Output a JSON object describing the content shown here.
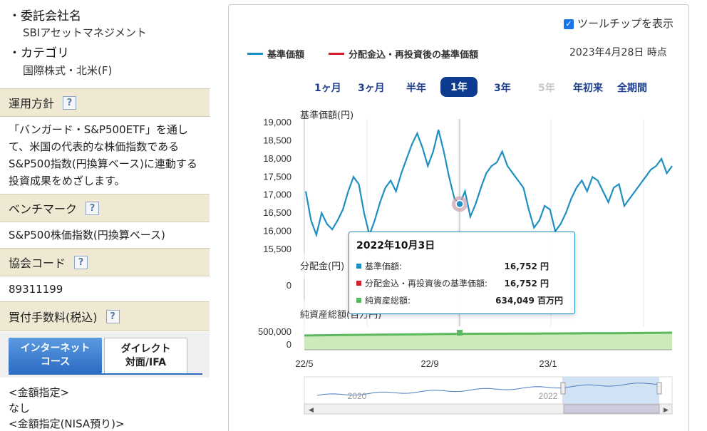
{
  "fund": {
    "trustee_label": "・委託会社名",
    "trustee_value": "SBIアセットマネジメント",
    "category_label": "・カテゴリ",
    "category_value": "国際株式・北米(F)"
  },
  "sections": {
    "policy_title": "運用方針",
    "policy_text": "「バンガード・S&P500ETF」を通して、米国の代表的な株価指数であるS&P500指数(円換算ベース)に連動する投資成果をめざします。",
    "benchmark_title": "ベンチマーク",
    "benchmark_text": "S&P500株価指数(円換算ベース)",
    "code_title": "協会コード",
    "code_text": "89311199",
    "fee_title": "買付手数料(税込)",
    "help_icon": "?"
  },
  "tabs": {
    "internet_line1": "インターネット",
    "internet_line2": "コース",
    "direct_line1": "ダイレクト",
    "direct_line2": "対面/IFA"
  },
  "fee_notes": {
    "amount": "<金額指定>",
    "amount_value": "なし",
    "nisa": "<金額指定(NISA預り)>"
  },
  "chart_ui": {
    "tooltip_toggle_label": "ツールチップを表示",
    "legend_nav": "基準価額",
    "legend_div": "分配金込・再投資後の基準価額",
    "as_of": "2023年4月28日 時点",
    "periods": [
      "1ヶ月",
      "3ヶ月",
      "半年",
      "1年",
      "3年",
      "5年",
      "年初来",
      "全期間"
    ],
    "active_period": "1年",
    "nav_axis_title": "基準価額(円)",
    "dist_axis_title": "分配金(円)",
    "assets_axis_title": "純資産総額(百万円)",
    "colors": {
      "nav": "#1f8fc2",
      "div": "#d11f2a",
      "assets": "#5cb85c",
      "accent": "#0d3b8f"
    }
  },
  "tooltip": {
    "date": "2022年10月3日",
    "nav_label": "基準価額:",
    "nav_value": "16,752 円",
    "div_label": "分配金込・再投資後の基準価額:",
    "div_value": "16,752 円",
    "assets_label": "純資産総額:",
    "assets_value": "634,049 百万円"
  },
  "chart_data": {
    "type": "line",
    "x_ticks": [
      "22/5",
      "22/9",
      "23/1"
    ],
    "y_ticks": [
      "19,000",
      "18,500",
      "18,000",
      "17,500",
      "17,000",
      "16,500",
      "16,000",
      "15,500"
    ],
    "ylim": [
      15500,
      19000
    ],
    "dist_ticks": [
      "0"
    ],
    "assets_ticks": [
      "500,000",
      "0"
    ],
    "navigator_labels": [
      "2020",
      "2022"
    ],
    "series": [
      {
        "name": "基準価額",
        "values": [
          17100,
          16300,
          15900,
          16500,
          16200,
          16050,
          16300,
          16600,
          17100,
          17500,
          17300,
          16500,
          15900,
          16300,
          16800,
          17200,
          17400,
          17100,
          17600,
          18000,
          18400,
          18700,
          18300,
          17800,
          18200,
          18800,
          18200,
          17500,
          16900,
          16750,
          17100,
          16400,
          16752,
          17200,
          17600,
          17800,
          17900,
          18200,
          17800,
          17600,
          17400,
          17200,
          16600,
          16100,
          16300,
          16700,
          16600,
          16000,
          16200,
          16500,
          16900,
          17200,
          17400,
          17100,
          17500,
          17400,
          17100,
          16800,
          17200,
          17300,
          16700,
          16900,
          17100,
          17300,
          17500,
          17700,
          17800,
          18000,
          17600,
          17800
        ]
      },
      {
        "name": "純資産総額",
        "values": [
          540000,
          550000,
          560000,
          570000,
          580000,
          590000,
          600000,
          610000,
          620000,
          625000,
          630000,
          634049,
          636000,
          640000,
          645000,
          650000,
          655000,
          660000,
          670000,
          680000
        ]
      }
    ]
  }
}
